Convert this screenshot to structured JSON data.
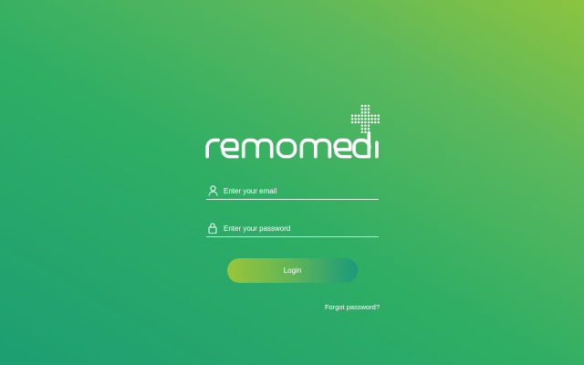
{
  "brand": {
    "logo_text": "remomedi",
    "logo_icon": "dotted-plus-icon"
  },
  "login_form": {
    "email": {
      "icon": "user-icon",
      "placeholder": "Enter your email",
      "value": ""
    },
    "password": {
      "icon": "lock-icon",
      "placeholder": "Enter your password",
      "value": ""
    },
    "submit_label": "Login",
    "forgot_password_label": "Forgot password?"
  },
  "colors": {
    "background_top_right": "#8cc43f",
    "background_bottom_left": "#1d9e73",
    "button_start": "#9ac53a",
    "button_end": "#1a9a7c",
    "text": "#ffffff"
  }
}
